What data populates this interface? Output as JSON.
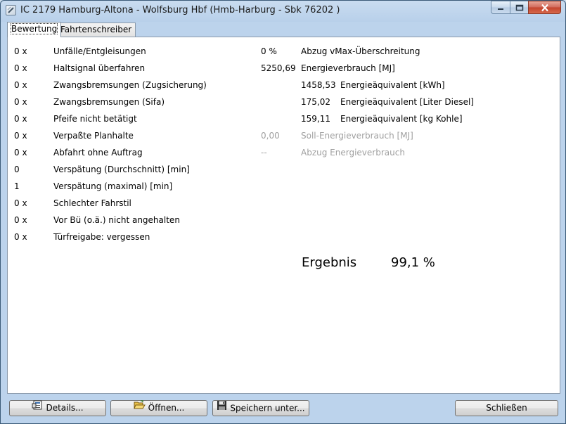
{
  "window": {
    "title": "IC 2179 Hamburg-Altona - Wolfsburg Hbf (Hmb-Harburg - Sbk 76202 )"
  },
  "tabs": [
    {
      "label": "Bewertung",
      "active": true
    },
    {
      "label": "Fahrtenschreiber",
      "active": false
    }
  ],
  "left_rows": [
    {
      "value": "0 x",
      "label": "Unfälle/Entgleisungen"
    },
    {
      "value": "0 x",
      "label": "Haltsignal überfahren"
    },
    {
      "value": "0 x",
      "label": "Zwangsbremsungen (Zugsicherung)"
    },
    {
      "value": "0 x",
      "label": "Zwangsbremsungen (Sifa)"
    },
    {
      "value": "0 x",
      "label": "Pfeife nicht betätigt"
    },
    {
      "value": "0 x",
      "label": "Verpaßte Planhalte"
    },
    {
      "value": "0 x",
      "label": "Abfahrt ohne Auftrag"
    },
    {
      "value": "0",
      "label": "Verspätung (Durchschnitt) [min]"
    },
    {
      "value": "1",
      "label": "Verspätung (maximal) [min]"
    },
    {
      "value": "0 x",
      "label": "Schlechter Fahrstil"
    },
    {
      "value": "0 x",
      "label": "Vor Bü (o.ä.) nicht angehalten"
    },
    {
      "value": "0 x",
      "label": "Türfreigabe: vergessen"
    }
  ],
  "right_rows": {
    "vmax": {
      "value": "0 %",
      "label": "Abzug vMax-Überschreitung"
    },
    "energy": {
      "value": "5250,69",
      "label": "Energieverbrauch [MJ]"
    },
    "kwh": {
      "value": "1458,53",
      "label": "Energieäquivalent [kWh]"
    },
    "diesel": {
      "value": "175,02",
      "label": "Energieäquivalent [Liter Diesel]"
    },
    "coal": {
      "value": "159,11",
      "label": "Energieäquivalent [kg Kohle]"
    },
    "target": {
      "value": "0,00",
      "label": "Soll-Energieverbrauch [MJ]"
    },
    "deduction": {
      "value": "--",
      "label": "Abzug Energieverbrauch"
    }
  },
  "result": {
    "label": "Ergebnis",
    "value": "99,1 %"
  },
  "buttons": {
    "details": "Details...",
    "open": "Öffnen...",
    "save": "Speichern unter...",
    "close": "Schließen"
  },
  "colors": {
    "disabled_text": "#a0a0a0",
    "title_bar": "#b8d0ea",
    "close_button": "#c4422c"
  }
}
